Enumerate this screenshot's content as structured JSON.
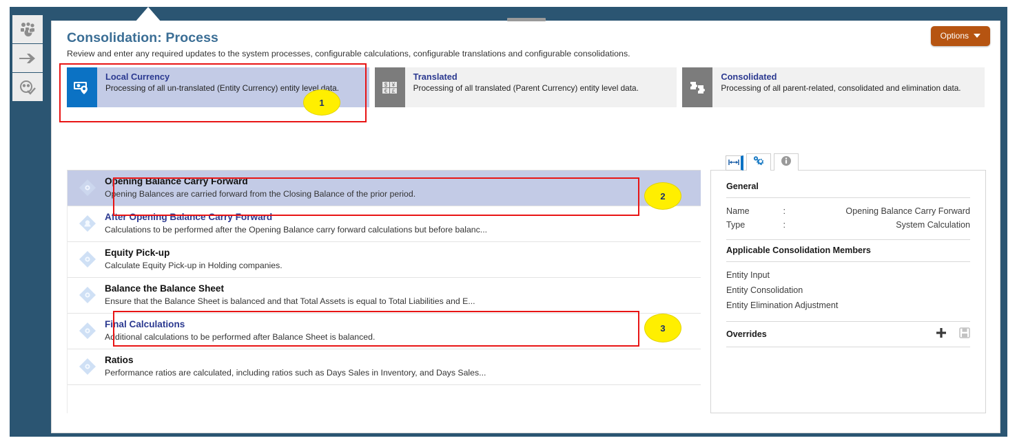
{
  "window": {
    "title": "Consolidation: Process",
    "subtitle": "Review and enter any required updates to the system processes, configurable calculations, configurable translations and configurable consolidations.",
    "options_button": "Options"
  },
  "rail": {
    "items": [
      {
        "name": "users-chart-icon"
      },
      {
        "name": "arrow-right-icon"
      },
      {
        "name": "approvals-check-icon"
      }
    ]
  },
  "tiles": [
    {
      "name": "Local Currency",
      "desc": "Processing of all un-translated (Entity Currency) entity level data.",
      "icon": "local-currency-icon",
      "state": "active"
    },
    {
      "name": "Translated",
      "desc": "Processing of all translated (Parent Currency) entity level data.",
      "icon": "currency-grid-icon",
      "state": "inactive"
    },
    {
      "name": "Consolidated",
      "desc": "Processing of all parent-related, consolidated and elimination data.",
      "icon": "puzzle-icon",
      "state": "inactive"
    }
  ],
  "tabstrip": {
    "collapse": "collapse-panel-icon",
    "tabs": [
      {
        "name": "settings-gear-icon",
        "selected": true
      },
      {
        "name": "info-icon",
        "selected": false
      }
    ]
  },
  "process_list": [
    {
      "title": "Opening Balance Carry Forward",
      "desc": "Opening Balances are carried forward from the Closing Balance of the prior period.",
      "selected": true,
      "link": false
    },
    {
      "title": "After Opening Balance Carry Forward",
      "desc": "Calculations to be performed after the Opening Balance carry forward calculations but before balanc...",
      "selected": false,
      "link": true
    },
    {
      "title": "Equity Pick-up",
      "desc": "Calculate Equity Pick-up in Holding companies.",
      "selected": false,
      "link": false
    },
    {
      "title": "Balance the Balance Sheet",
      "desc": "Ensure that the Balance Sheet is balanced and that Total Assets is equal to Total Liabilities and E...",
      "selected": false,
      "link": false
    },
    {
      "title": "Final Calculations",
      "desc": "Additional calculations to be performed after Balance Sheet is balanced.",
      "selected": false,
      "link": true
    },
    {
      "title": "Ratios",
      "desc": "Performance ratios are calculated, including ratios such as Days Sales in Inventory, and Days Sales...",
      "selected": false,
      "link": false
    }
  ],
  "details": {
    "general_heading": "General",
    "name_label": "Name",
    "name_value": "Opening Balance Carry Forward",
    "type_label": "Type",
    "type_value": "System Calculation",
    "colon": ":",
    "members_heading": "Applicable Consolidation Members",
    "members": [
      "Entity Input",
      "Entity Consolidation",
      "Entity Elimination Adjustment"
    ],
    "overrides_heading": "Overrides",
    "add_icon": "add-plus-icon",
    "save_icon": "save-disk-icon"
  },
  "annotations": [
    {
      "label": "1"
    },
    {
      "label": "2"
    },
    {
      "label": "3"
    }
  ],
  "colors": {
    "chrome": "#2b5572",
    "title": "#3b6e95",
    "tile_active_icon": "#0b72c4",
    "tile_active_body": "#c3cbe6",
    "tile_inactive_icon": "#7c7c7c",
    "tile_inactive_body": "#f1f1f1",
    "link": "#2b3990",
    "options": "#b65411",
    "annotation": "#e81313",
    "badge": "#ffef00"
  }
}
